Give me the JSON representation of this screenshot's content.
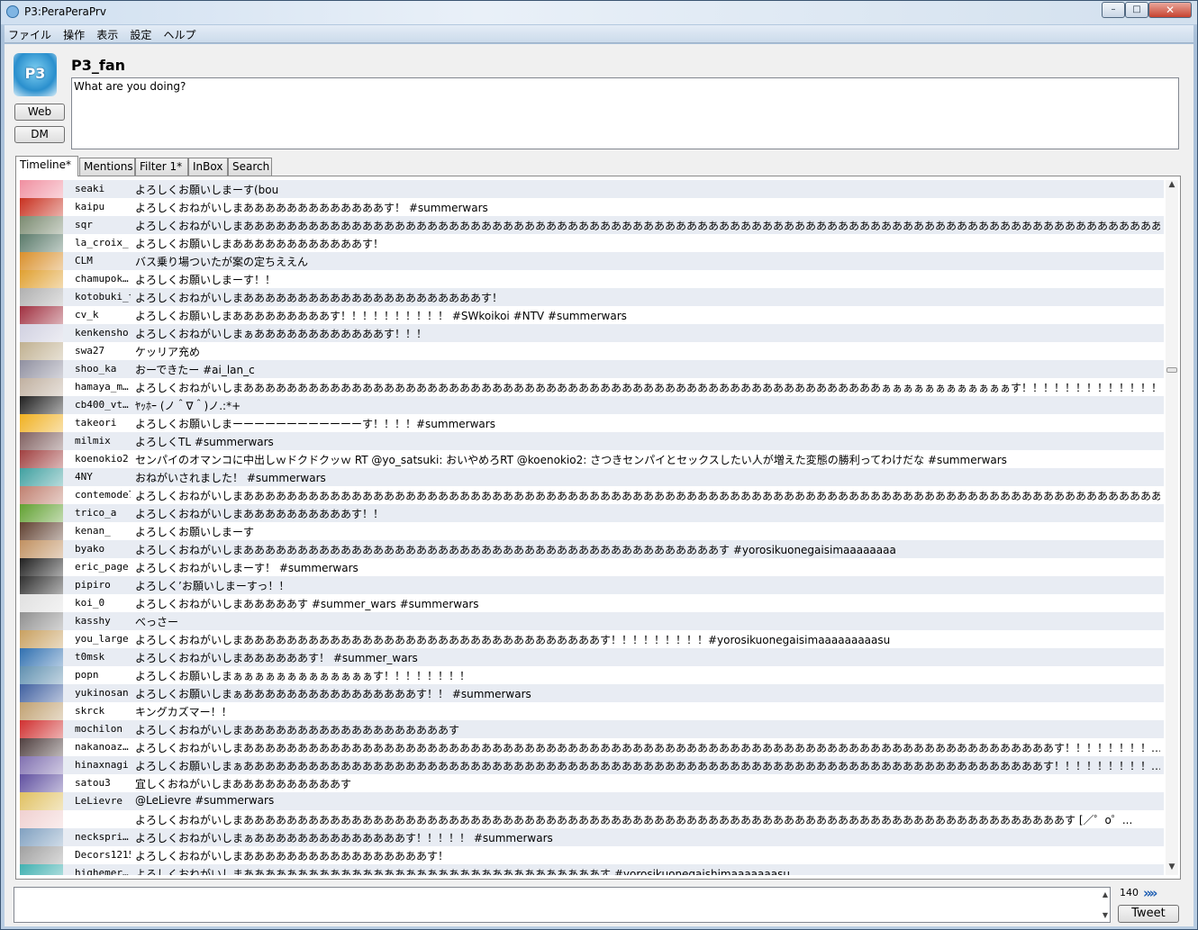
{
  "window": {
    "title": "P3:PeraPeraPrv",
    "minimize": "–",
    "maximize": "□",
    "close": "✕"
  },
  "menu": [
    "ファイル",
    "操作",
    "表示",
    "設定",
    "ヘルプ"
  ],
  "profile": {
    "name": "P3_fan",
    "web_label": "Web",
    "dm_label": "DM",
    "status_prompt": "What are you doing?",
    "avatar_text": "P3"
  },
  "tabs": [
    "Timeline*",
    "Mentions",
    "Filter 1*",
    "InBox",
    "Search"
  ],
  "timeline": [
    {
      "user": "seaki",
      "text": "よろしくお願いしまーす(bou",
      "color": "#f08fa0"
    },
    {
      "user": "kaipu",
      "text": "よろしくおねがいしまあああああああああああああす！ #summerwars",
      "color": "#c8301f"
    },
    {
      "user": "sqr",
      "text": "よろしくおねがいしまあああああああああああああああああああああああああああああああああああああああああああああああああああああああああああああああああああああああああああああああああああああああ…",
      "color": "#7a8a70"
    },
    {
      "user": "la_croix_",
      "text": "よろしくお願いしまああああああああああああす！",
      "color": "#5a7a6a"
    },
    {
      "user": "CLM",
      "text": "バス乗り場ついたが案の定ちええん",
      "color": "#d98f2a"
    },
    {
      "user": "chamupok…",
      "text": "よろしくお願いしまーす！！",
      "color": "#e0a030"
    },
    {
      "user": "kotobuki_t",
      "text": "よろしくおねがいしまああああああああああああああああああああああす！",
      "color": "#b0b0b0"
    },
    {
      "user": "cv_k",
      "text": "よろしくお願いしまあああああああああす！！！！！！！！！！ #SWkoikoi #NTV #summerwars",
      "color": "#a03040"
    },
    {
      "user": "kenkensho",
      "text": "よろしくおねがいしまぁああああああああああああす！！！",
      "color": "#d0d0e0"
    },
    {
      "user": "swa27",
      "text": "ケッリア充め",
      "color": "#c0b090"
    },
    {
      "user": "shoo_ka",
      "text": "おーできたー #ai_lan_c",
      "color": "#9090a0"
    },
    {
      "user": "hamaya_m…",
      "text": "よろしくおねがいしまあああああああああああああああああああああああああああああああああああああああああああああああああああああああああああぁぁぁぁぁぁぁぁぁぁぁぁす！！！！！！！！！！！！！！…",
      "color": "#c0b0a0"
    },
    {
      "user": "cb400_vt…",
      "text": "ﾔｯﾎｰ (ノ＾∇＾)ノ.:*+",
      "color": "#202020"
    },
    {
      "user": "takeori",
      "text": "よろしくお願いしまーーーーーーーーーーーーす！！！！#summerwars",
      "color": "#f0b020"
    },
    {
      "user": "milmix",
      "text": "よろしくTL #summerwars",
      "color": "#806060"
    },
    {
      "user": "koenokio2",
      "text": "センパイのオマンコに中出しｗドクドクッｗ RT @yo_satsuki: おいやめろRT @koenokio2: さつきセンパイとセックスしたい人が増えた変態の勝利ってわけだな #summerwars",
      "color": "#a04040"
    },
    {
      "user": "4NY",
      "text": "おねがいされました！ #summerwars",
      "color": "#40a0a0"
    },
    {
      "user": "contemode7",
      "text": "よろしくおねがいしまああああああああああああああああああああああああああああああああああああああああああああああああああああああああああああああああああああああああああああああああああああああ…",
      "color": "#c08070"
    },
    {
      "user": "trico_a",
      "text": "よろしくおねがいしまああああああああああす！！",
      "color": "#60a030"
    },
    {
      "user": "kenan_",
      "text": "よろしくお願いしまーす",
      "color": "#604030"
    },
    {
      "user": "byako",
      "text": "よろしくおねがいしまああああああああああああああああああああああああああああああああああああああああああああす #yorosikuonegaisimaaaaaaaa",
      "color": "#c09060"
    },
    {
      "user": "eric_page",
      "text": "よろしくおねがいしまーす！ #summerwars",
      "color": "#202020"
    },
    {
      "user": "pipiro",
      "text": "よろしく’お願いしまーすっ！！",
      "color": "#303030"
    },
    {
      "user": "koi_0",
      "text": "よろしくおねがいしまあああああす #summer_wars #summerwars",
      "color": "#e0e0e0"
    },
    {
      "user": "kasshy",
      "text": "べっさー",
      "color": "#909090"
    },
    {
      "user": "you_large",
      "text": "よろしくおねがいしまあああああああああああああああああああああああああああああああああす！！！！！！！！！#yorosikuonegaisimaaaaaaaaasu",
      "color": "#c8a060"
    },
    {
      "user": "t0msk",
      "text": "よろしくおねがいしまああああああす！ #summer_wars",
      "color": "#3070b0"
    },
    {
      "user": "popn",
      "text": "よろしくお願いしまぁぁぁぁぁぁぁぁぁぁぁぁぁす！！！！！！！！",
      "color": "#6090b0"
    },
    {
      "user": "yukinosan",
      "text": "よろしくお願いしまぁああああああああああああああああす！！ #summerwars",
      "color": "#4060a0"
    },
    {
      "user": "skrck",
      "text": "キングカズマー！！",
      "color": "#c0a070"
    },
    {
      "user": "mochilon",
      "text": "よろしくおねがいしまあああああああああああああああああああす",
      "color": "#d03030"
    },
    {
      "user": "nakanoaz…",
      "text": "よろしくおねがいしまあああああああああああああああああああああああああああああああああああああああああああああああああああああああああああああああああああああああああああす！！！！！！！！…",
      "color": "#504040"
    },
    {
      "user": "hinaxnagi",
      "text": "よろしくお願いしまぁああああああああああああああああああああああああああああああああああああああああああああああああああああああああああああああああああああああああああす！！！！！！！！！…",
      "color": "#8070b0"
    },
    {
      "user": "satou3",
      "text": "宜しくおねがいしまああああああああああす",
      "color": "#6050a0"
    },
    {
      "user": "LeLievre",
      "text": "@LeLievre #summerwars",
      "color": "#e0c060"
    },
    {
      "user": "",
      "text": "よろしくおねがいしまああああああああああああああああああああああああああああああああああああああああああああああああああああああああああああああああああああああああああああす [／゜o゜...",
      "color": "#f0d0d0"
    },
    {
      "user": "neckspri…",
      "text": "よろしくおねがいしまぁああああああああああああああす！！！！！ #summerwars",
      "color": "#80a0c0"
    },
    {
      "user": "Decors1215",
      "text": "よろしくおねがいしまあああああああああああああああああす！",
      "color": "#a0a0a0"
    },
    {
      "user": "highemer…",
      "text": "よろしくおねがいしまあああああああああああああああああああああああああああああああああす #yorosikuonegaishimaaaaaaasu",
      "color": "#40b0b0"
    }
  ],
  "composer": {
    "count": "140",
    "tweet_label": "Tweet",
    "arrows": "»»"
  },
  "scroll": {
    "up": "▲",
    "down": "▼"
  }
}
